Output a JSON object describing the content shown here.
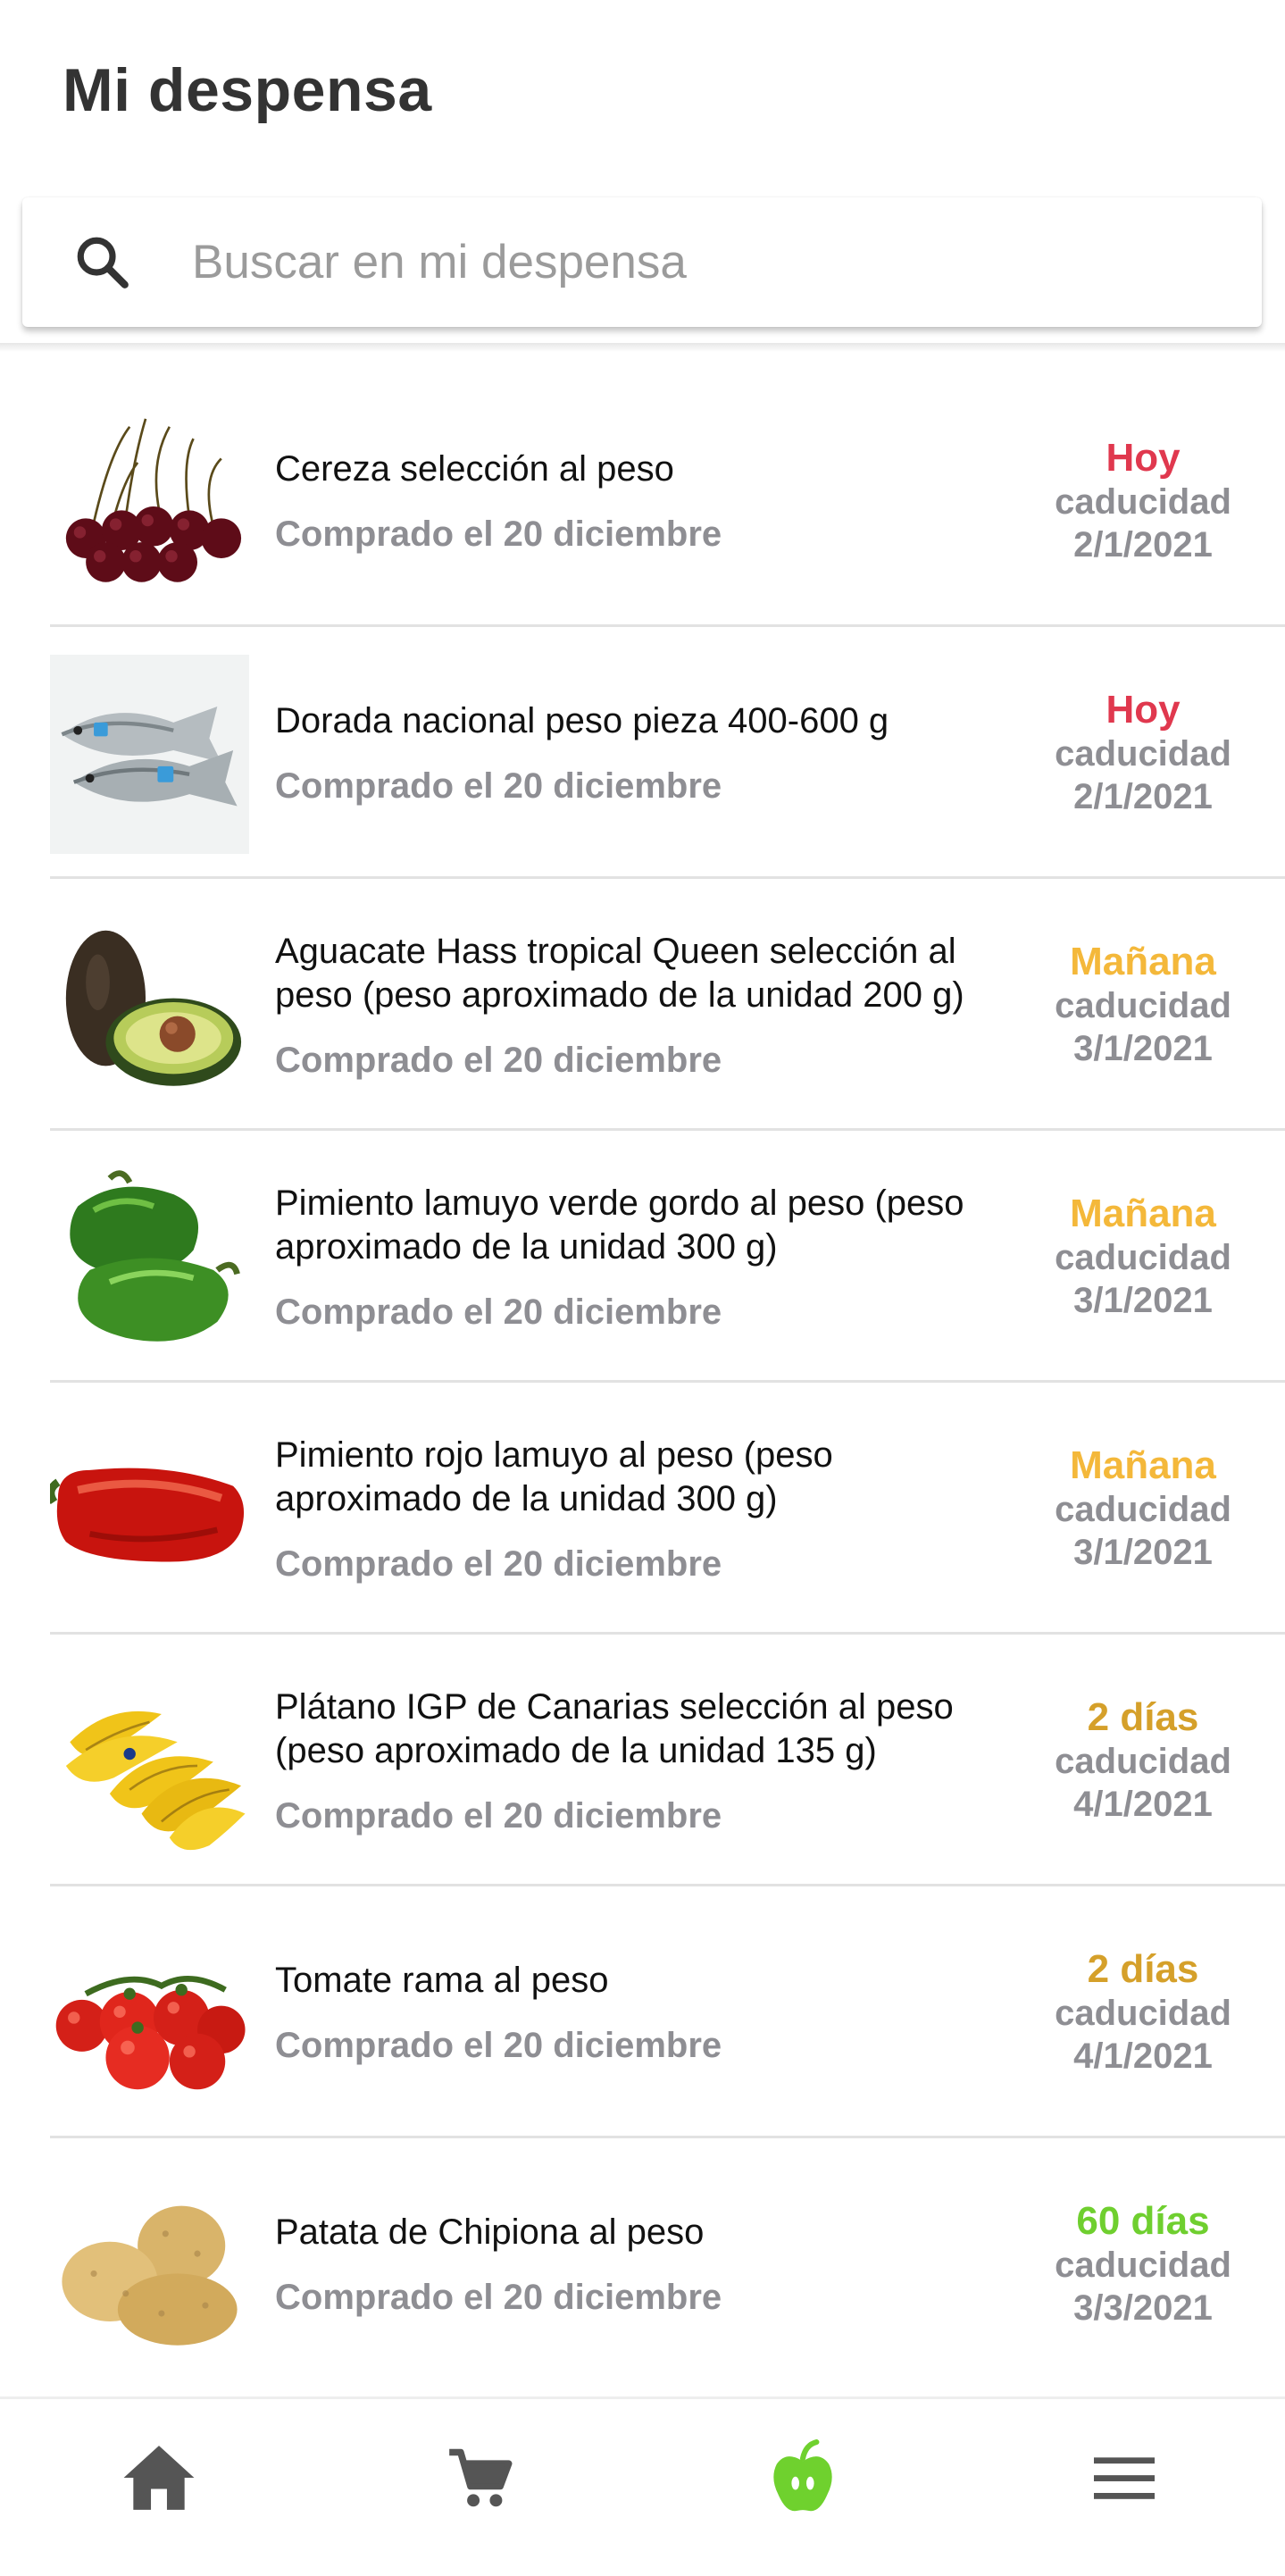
{
  "header": {
    "title": "Mi despensa"
  },
  "search": {
    "placeholder": "Buscar en mi despensa",
    "icon": "search-icon"
  },
  "colors": {
    "today": "#e0384e",
    "tomorrow": "#f4b83a",
    "two_days": "#d5a02a",
    "many_days": "#6fcf2f",
    "muted": "#8e8e93",
    "active_nav": "#6fd12e",
    "nav": "#555555"
  },
  "items": [
    {
      "name": "Cereza selección al peso",
      "bought": "Comprado el 20 diciembre",
      "days": "Hoy",
      "status": "today",
      "expiry_label": "caducidad",
      "expiry_date": "2/1/2021",
      "image": "cherries"
    },
    {
      "name": "Dorada nacional peso pieza 400-600 g",
      "bought": "Comprado el 20 diciembre",
      "days": "Hoy",
      "status": "today",
      "expiry_label": "caducidad",
      "expiry_date": "2/1/2021",
      "image": "fish"
    },
    {
      "name": "Aguacate Hass tropical Queen selección al peso (peso aproximado de la unidad 200 g)",
      "bought": "Comprado el 20 diciembre",
      "days": "Mañana",
      "status": "tomorrow",
      "expiry_label": "caducidad",
      "expiry_date": "3/1/2021",
      "image": "avocado"
    },
    {
      "name": "Pimiento lamuyo verde gordo al peso (peso aproximado de la unidad 300 g)",
      "bought": "Comprado el 20 diciembre",
      "days": "Mañana",
      "status": "tomorrow",
      "expiry_label": "caducidad",
      "expiry_date": "3/1/2021",
      "image": "green-pepper"
    },
    {
      "name": "Pimiento rojo lamuyo al peso (peso aproximado de la unidad 300 g)",
      "bought": "Comprado el 20 diciembre",
      "days": "Mañana",
      "status": "tomorrow",
      "expiry_label": "caducidad",
      "expiry_date": "3/1/2021",
      "image": "red-pepper"
    },
    {
      "name": "Plátano IGP de Canarias selección al peso (peso aproximado de la unidad 135 g)",
      "bought": "Comprado el 20 diciembre",
      "days": "2 días",
      "status": "two_days",
      "expiry_label": "caducidad",
      "expiry_date": "4/1/2021",
      "image": "bananas"
    },
    {
      "name": "Tomate rama al peso",
      "bought": "Comprado el 20 diciembre",
      "days": "2 días",
      "status": "two_days",
      "expiry_label": "caducidad",
      "expiry_date": "4/1/2021",
      "image": "tomatoes"
    },
    {
      "name": "Patata de Chipiona al peso",
      "bought": "Comprado el 20 diciembre",
      "days": "60 días",
      "status": "many_days",
      "expiry_label": "caducidad",
      "expiry_date": "3/3/2021",
      "image": "potatoes"
    }
  ],
  "nav": [
    {
      "icon": "home-icon",
      "active": false
    },
    {
      "icon": "cart-icon",
      "active": false
    },
    {
      "icon": "apple-icon",
      "active": true
    },
    {
      "icon": "menu-icon",
      "active": false
    }
  ]
}
